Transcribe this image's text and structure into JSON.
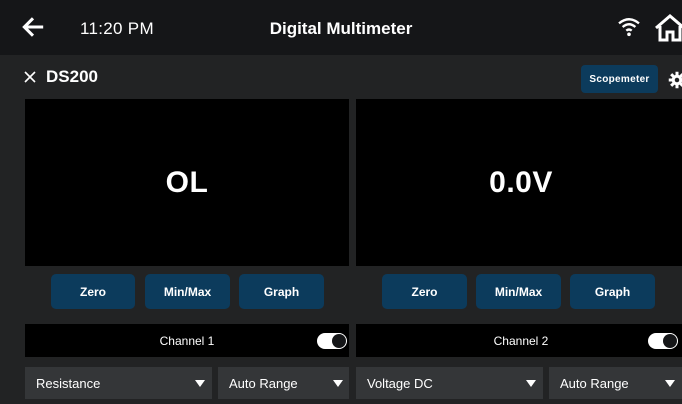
{
  "topbar": {
    "time": "11:20 PM",
    "title": "Digital Multimeter",
    "icons": [
      "back-arrow-icon",
      "wifi-icon",
      "home-icon"
    ]
  },
  "device": {
    "name": "DS200",
    "scopemeter_label": "Scopemeter"
  },
  "channels": [
    {
      "reading": "OL",
      "buttons": [
        "Zero",
        "Min/Max",
        "Graph"
      ],
      "label": "Channel 1",
      "enabled": true,
      "mode": "Resistance",
      "range": "Auto Range"
    },
    {
      "reading": "0.0V",
      "buttons": [
        "Zero",
        "Min/Max",
        "Graph"
      ],
      "label": "Channel 2",
      "enabled": true,
      "mode": "Voltage DC",
      "range": "Auto Range"
    }
  ],
  "colors": {
    "background": "#222324",
    "topbar": "#151618",
    "accent_button": "#0c3b5c",
    "display": "#000000",
    "dropdown": "#343638"
  }
}
